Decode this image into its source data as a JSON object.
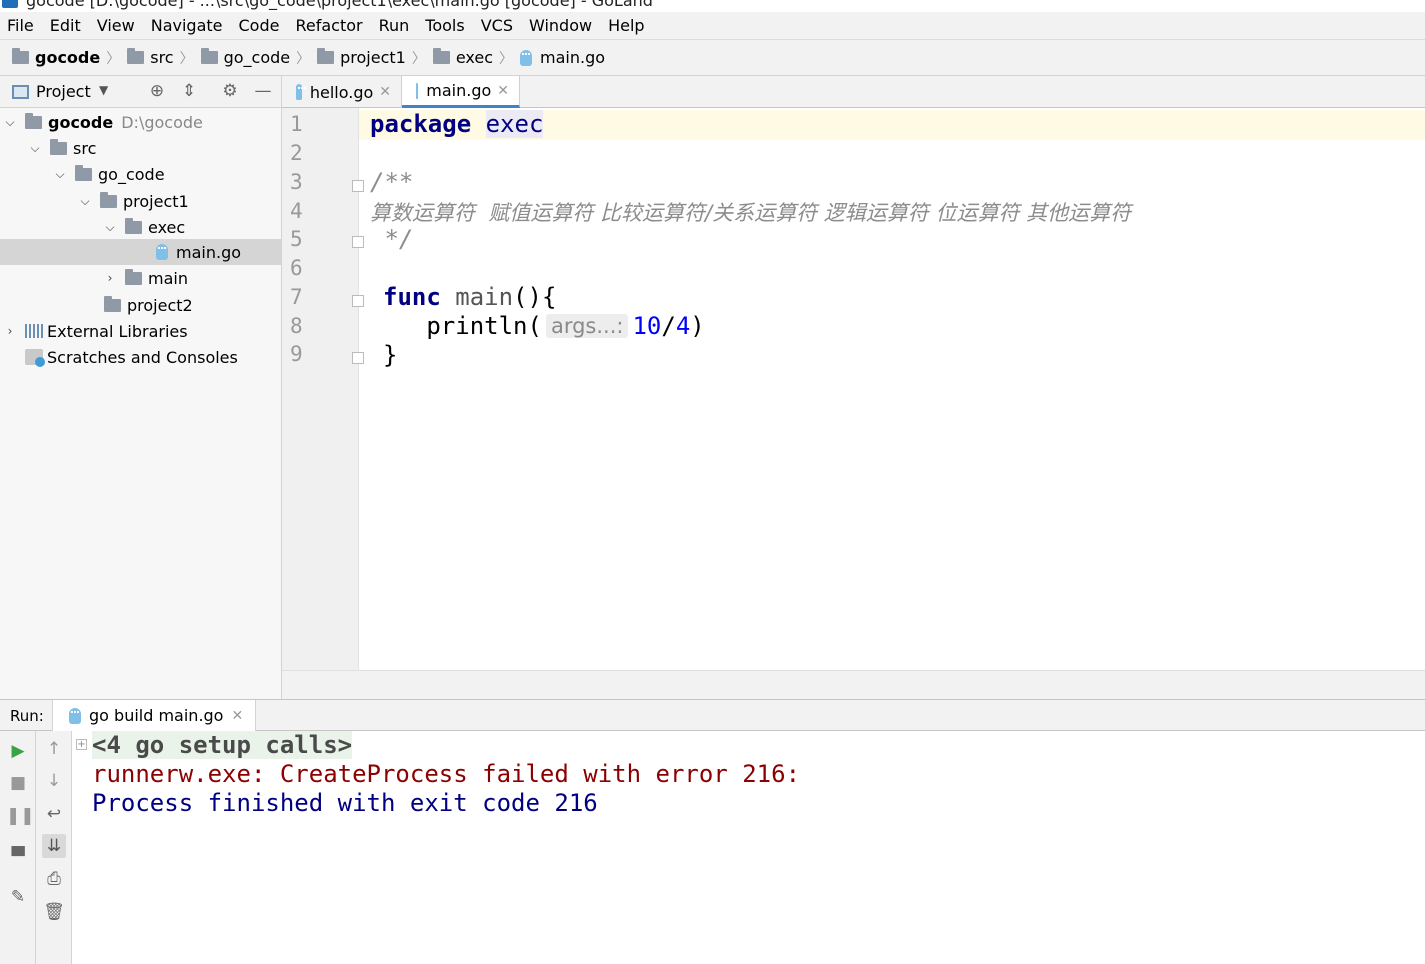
{
  "window": {
    "title": "gocode [D:\\gocode] - ...\\src\\go_code\\project1\\exec\\main.go [gocode] - GoLand"
  },
  "menu": [
    "File",
    "Edit",
    "View",
    "Navigate",
    "Code",
    "Refactor",
    "Run",
    "Tools",
    "VCS",
    "Window",
    "Help"
  ],
  "breadcrumb": [
    "gocode",
    "src",
    "go_code",
    "project1",
    "exec",
    "main.go"
  ],
  "project_panel": {
    "title": "Project",
    "tree": [
      {
        "label": "gocode",
        "hint": "D:\\gocode",
        "bold": true
      },
      {
        "label": "src"
      },
      {
        "label": "go_code"
      },
      {
        "label": "project1"
      },
      {
        "label": "exec"
      },
      {
        "label": "main.go",
        "selected": true
      },
      {
        "label": "main"
      },
      {
        "label": "project2"
      },
      {
        "label": "External Libraries"
      },
      {
        "label": "Scratches and Consoles"
      }
    ]
  },
  "editor": {
    "tabs": [
      {
        "label": "hello.go",
        "active": false
      },
      {
        "label": "main.go",
        "active": true
      }
    ],
    "line_numbers": [
      "1",
      "2",
      "3",
      "4",
      "5",
      "6",
      "7",
      "8",
      "9"
    ],
    "code": {
      "l1_kw": "package",
      "l1_ident": "exec",
      "l3": "/**",
      "l4": "算数运算符  赋值运算符 比较运算符/关系运算符 逻辑运算符 位运算符 其他运算符",
      "l5": " */",
      "l7_kw": "func",
      "l7_name": "main",
      "l7_rest": "(){",
      "l8_fn": "   println(",
      "l8_hint": "args...:",
      "l8_num1": "10",
      "l8_op": "/",
      "l8_num2": "4",
      "l8_end": ")",
      "l9": "}"
    }
  },
  "run_panel": {
    "label": "Run:",
    "tab": "go build main.go",
    "output": {
      "setup": "<4 go setup calls>",
      "error": "runnerw.exe: CreateProcess failed with error 216:",
      "exit": "Process finished with exit code 216"
    }
  },
  "colors": {
    "keyword": "#000080",
    "comment": "#8c8c8c",
    "number": "#0000ff",
    "error_text": "#8b0000",
    "run_green": "#3aa345",
    "tab_underline": "#4083c9"
  }
}
